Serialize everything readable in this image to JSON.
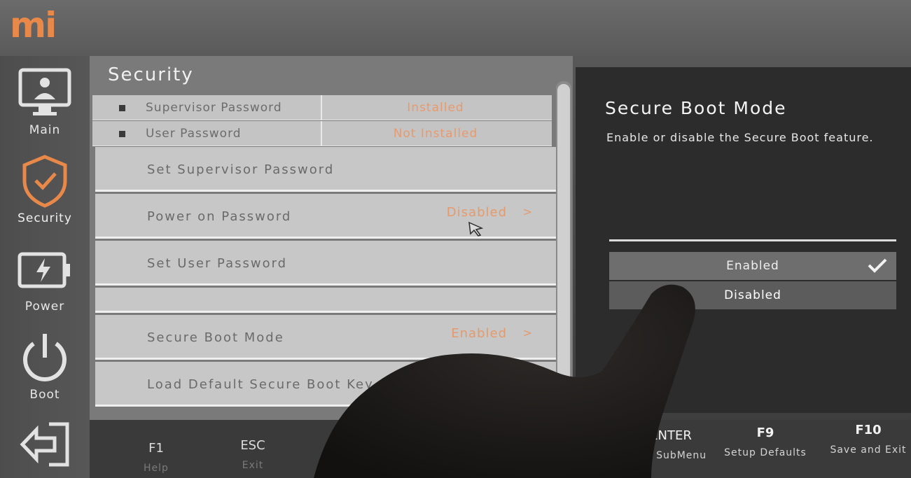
{
  "brand": {
    "logo_text": "mi",
    "accent": "#e8894a"
  },
  "sidebar": {
    "items": [
      {
        "label": "Main",
        "icon": "monitor-user-icon"
      },
      {
        "label": "Security",
        "icon": "shield-check-icon",
        "active": true
      },
      {
        "label": "Power",
        "icon": "battery-bolt-icon"
      },
      {
        "label": "Boot",
        "icon": "power-icon"
      },
      {
        "label": "",
        "icon": "exit-arrow-icon"
      }
    ]
  },
  "main": {
    "title": "Security",
    "status": [
      {
        "name": "Supervisor Password",
        "value": "Installed"
      },
      {
        "name": "User Password",
        "value": "Not Installed"
      }
    ],
    "menu": [
      {
        "name": "Set Supervisor Password",
        "value": ""
      },
      {
        "name": "Power on Password",
        "value": "Disabled",
        "chevron": ">"
      },
      {
        "name": "Set User Password",
        "value": ""
      },
      {
        "name": "",
        "value": ""
      },
      {
        "name": "Secure Boot Mode",
        "value": "Enabled",
        "chevron": ">"
      },
      {
        "name": "Load Default Secure Boot Key",
        "value": ""
      }
    ]
  },
  "help": {
    "title": "Secure Boot Mode",
    "description": "Enable or disable the Secure Boot feature.",
    "options": [
      {
        "label": "Enabled",
        "selected": true
      },
      {
        "label": "Disabled",
        "selected": false
      }
    ]
  },
  "footer": {
    "keys": [
      {
        "key": "F1",
        "desc": "Help"
      },
      {
        "key": "ESC",
        "desc": "Exit"
      },
      {
        "key": "↑",
        "desc": ""
      },
      {
        "key": "ENTER",
        "desc": "ect SubMenu"
      },
      {
        "key": "F9",
        "desc": "Setup Defaults"
      },
      {
        "key": "F10",
        "desc": "Save and Exit"
      }
    ]
  }
}
